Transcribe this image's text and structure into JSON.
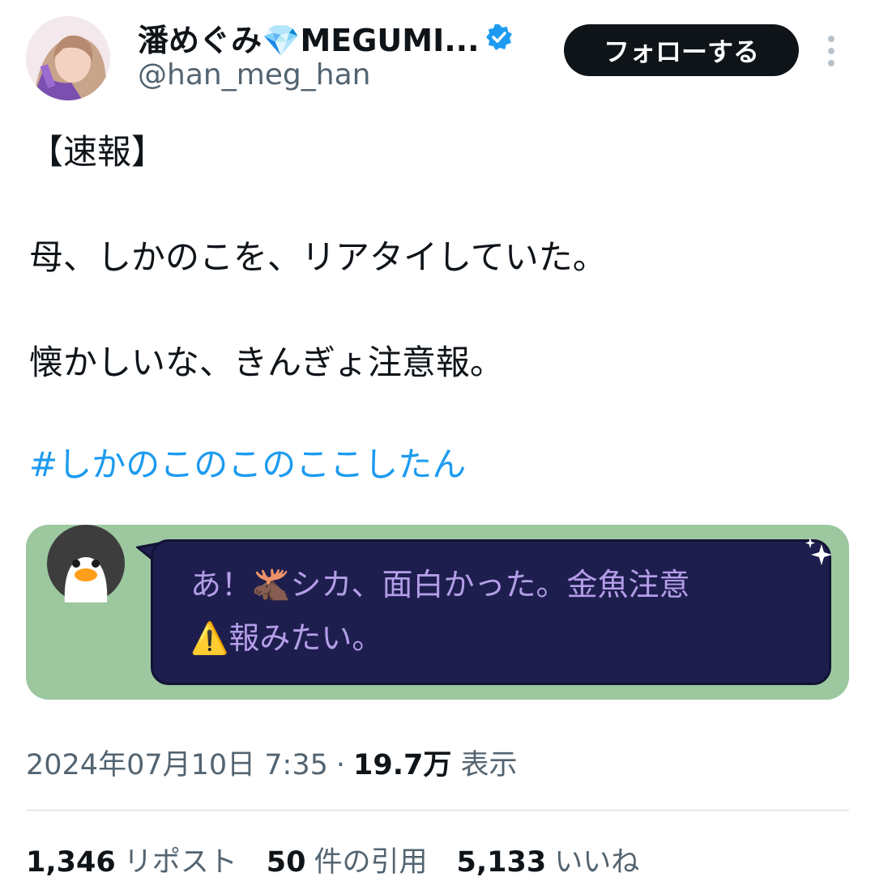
{
  "author": {
    "display_name": "潘めぐみ💎MEGUMI...",
    "handle": "@han_meg_han",
    "verified": true
  },
  "follow_button": "フォローする",
  "tweet": {
    "line1": "【速報】",
    "line2": "母、しかのこを、リアタイしていた。",
    "line3": "懐かしいな、きんぎょ注意報。",
    "hashtag": "#しかのこのこのここしたん"
  },
  "card": {
    "bubble_line1": "あ！🫎シカ、面白かった。金魚注意",
    "bubble_line2": "⚠️報みたい。"
  },
  "meta": {
    "timestamp": "2024年07月10日 7:35",
    "separator": "·",
    "views_value": "19.7万",
    "views_label": "表示"
  },
  "stats": {
    "reposts_value": "1,346",
    "reposts_label": "リポスト",
    "quotes_value": "50",
    "quotes_label": "件の引用",
    "likes_value": "5,133",
    "likes_label": "いいね"
  },
  "colors": {
    "hashtag": "#1d9bf0",
    "verified": "#1d9bf0",
    "card_bg": "#9cc79f",
    "bubble_bg": "#1e1e4e",
    "bubble_text": "#b49ee8"
  },
  "icons": [
    "verified-badge-icon",
    "more-options-icon",
    "penguin-avatar-icon",
    "sparkle-icon"
  ]
}
